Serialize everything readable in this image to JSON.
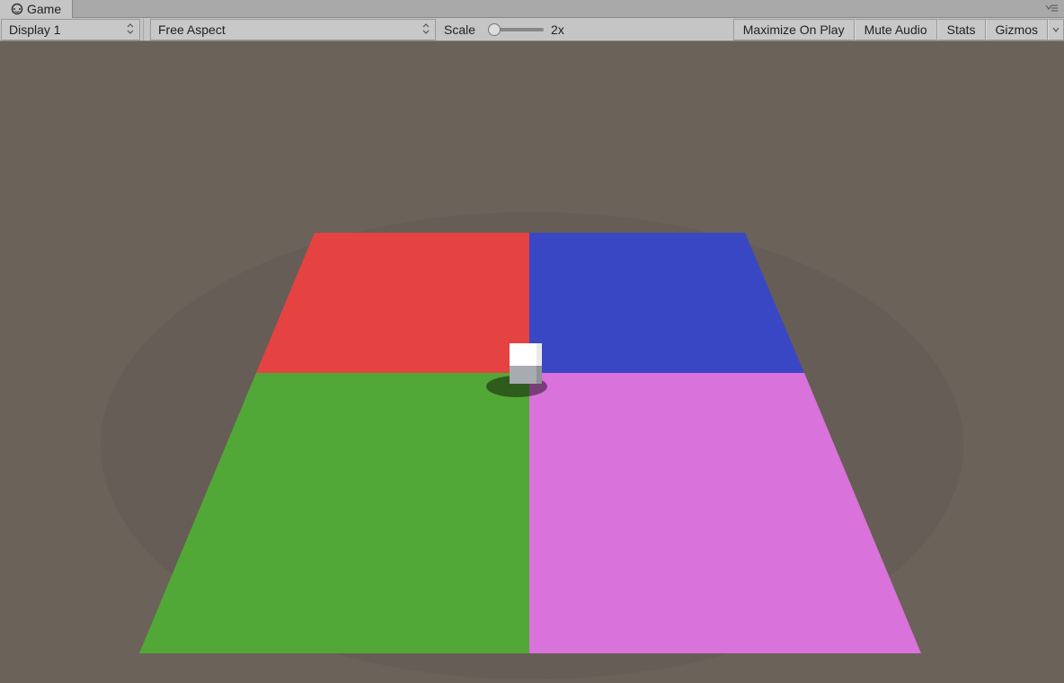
{
  "tab": {
    "label": "Game"
  },
  "toolbar": {
    "display": "Display 1",
    "aspect": "Free Aspect",
    "scale_label": "Scale",
    "scale_value": "2x",
    "maximize": "Maximize On Play",
    "mute": "Mute Audio",
    "stats": "Stats",
    "gizmos": "Gizmos"
  },
  "scene": {
    "quadrants": {
      "top_left": "#e54242",
      "top_right": "#3a47c4",
      "bottom_left": "#52a836",
      "bottom_right": "#da72db"
    },
    "cube": {
      "top": "#ffffff",
      "side": "#a8abb0"
    },
    "background": "#6b625a"
  }
}
